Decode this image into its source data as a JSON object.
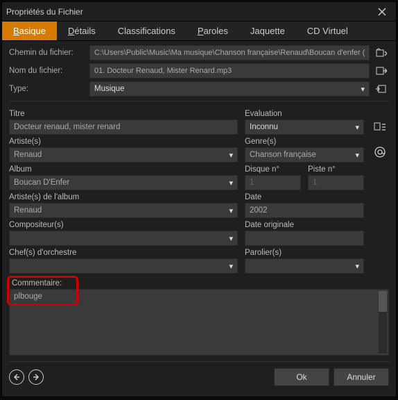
{
  "window": {
    "title": "Propriétés du Fichier"
  },
  "tabs": {
    "basique": "Basique",
    "details": "Détails",
    "classifications": "Classifications",
    "paroles": "Paroles",
    "jaquette": "Jaquette",
    "cdvirtuel": "CD Virtuel"
  },
  "path": {
    "label_path": "Chemin du fichier:",
    "value_path": "C:\\Users\\Public\\Music\\Ma musique\\Chanson française\\Renaud\\Boucan d'enfer (",
    "label_file": "Nom du fichier:",
    "value_file": "01. Docteur Renaud, Mister Renard.mp3",
    "label_type": "Type:",
    "value_type": "Musique"
  },
  "fields": {
    "titre_label": "Titre",
    "titre_value": "Docteur renaud, mister renard",
    "artiste_label": "Artiste(s)",
    "artiste_value": "Renaud",
    "album_label": "Album",
    "album_value": "Boucan D'Enfer",
    "albumartist_label": "Artiste(s) de l'album",
    "albumartist_value": "Renaud",
    "composer_label": "Compositeur(s)",
    "composer_value": "",
    "conductor_label": "Chef(s) d'orchestre",
    "conductor_value": "",
    "eval_label": "Evaluation",
    "eval_value": "Inconnu",
    "genre_label": "Genre(s)",
    "genre_value": "Chanson française",
    "disc_label": "Disque n°",
    "disc_value": "1",
    "track_label": "Piste n°",
    "track_value": "1",
    "date_label": "Date",
    "date_value": "2002",
    "origdate_label": "Date originale",
    "origdate_value": "",
    "parolier_label": "Parolier(s)",
    "parolier_value": ""
  },
  "comment": {
    "label": "Commentaire:",
    "value": "plbouge"
  },
  "footer": {
    "ok": "Ok",
    "cancel": "Annuler"
  }
}
